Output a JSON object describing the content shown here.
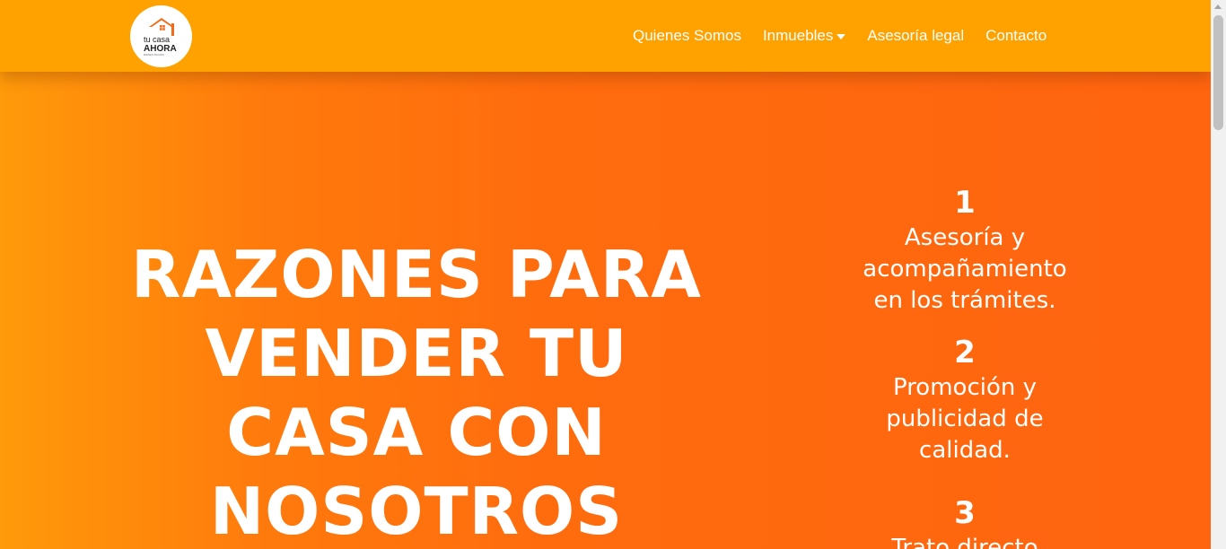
{
  "header": {
    "logo": {
      "line1": "tu casa",
      "line2": "AHORA",
      "tagline": "BIENES RAICES"
    },
    "nav": [
      {
        "label": "Quienes Somos"
      },
      {
        "label": "Inmuebles"
      },
      {
        "label": "Asesoría legal"
      },
      {
        "label": "Contacto"
      }
    ]
  },
  "hero": {
    "headline_lines": [
      "RAZONES PARA",
      "VENDER TU",
      "CASA CON",
      "NOSOTROS"
    ],
    "reasons": [
      {
        "number": "1",
        "text_lines": [
          "Asesoría y",
          "acompañamiento",
          "en los trámites."
        ]
      },
      {
        "number": "2",
        "text_lines": [
          "Promoción y",
          "publicidad de",
          "calidad."
        ]
      },
      {
        "number": "3",
        "text_lines": [
          "Trato directo"
        ]
      }
    ]
  },
  "colors": {
    "navbar": "#ffa200",
    "hero_start": "#ff9a0a",
    "hero_end": "#ff640f",
    "text": "#ffffff"
  },
  "icons": {
    "logo_mark": "house-icon",
    "dropdown": "caret-down-icon"
  }
}
